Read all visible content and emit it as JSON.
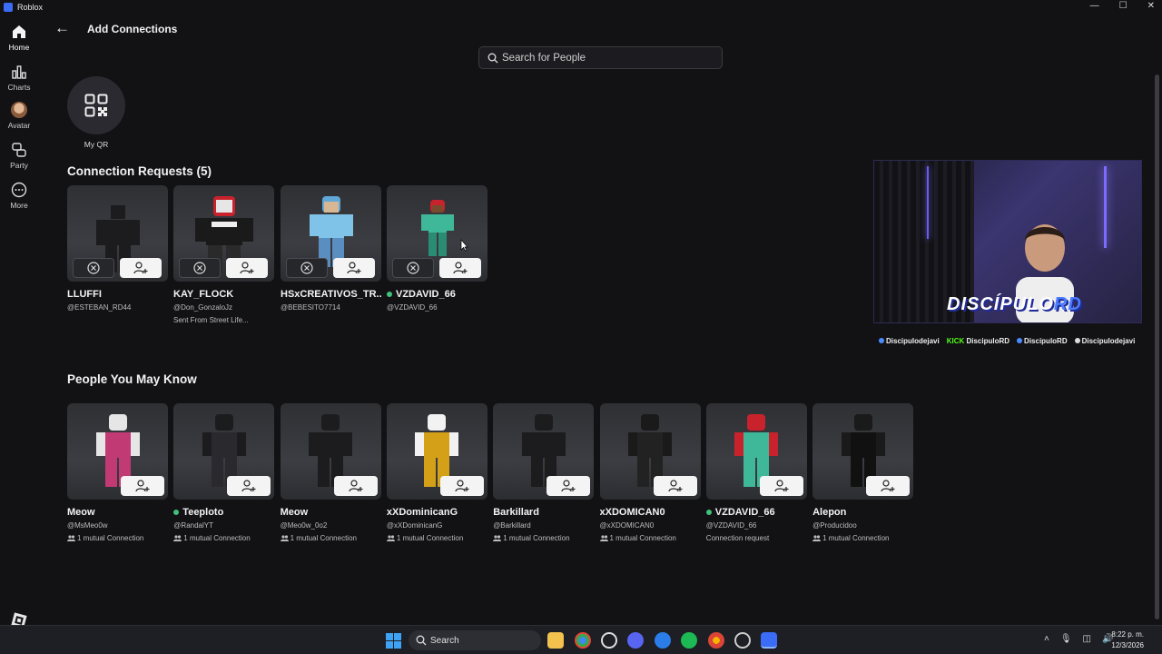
{
  "window": {
    "title": "Roblox",
    "controls": [
      "—",
      "☐",
      "✕"
    ]
  },
  "sidebar": {
    "items": [
      {
        "label": "Home",
        "icon": "home-icon"
      },
      {
        "label": "Charts",
        "icon": "charts-icon"
      },
      {
        "label": "Avatar",
        "icon": "avatar-icon"
      },
      {
        "label": "Party",
        "icon": "party-icon"
      },
      {
        "label": "More",
        "icon": "more-icon"
      }
    ]
  },
  "header": {
    "back": "←",
    "title": "Add Connections"
  },
  "search": {
    "placeholder": "Search for People"
  },
  "qr": {
    "label": "My QR"
  },
  "requests": {
    "title": "Connection Requests (5)",
    "items": [
      {
        "name": "LLUFFI",
        "handle": "@ESTEBAN_RD44",
        "sub": "",
        "online": false
      },
      {
        "name": "KAY_FLOCK",
        "handle": "@Don_GonzaloJz",
        "sub": "Sent From Street Life...",
        "online": false
      },
      {
        "name": "HSxCREATIVOS_TR...",
        "handle": "@BEBESITO7714",
        "sub": "",
        "online": false
      },
      {
        "name": "VZDAVID_66",
        "handle": "@VZDAVID_66",
        "sub": "",
        "online": true
      }
    ]
  },
  "pymk": {
    "title": "People You May Know",
    "items": [
      {
        "name": "Meow",
        "handle": "@MsMeo0w",
        "sub": "1 mutual Connection",
        "online": false
      },
      {
        "name": "Teeploto",
        "handle": "@RandalYT",
        "sub": "1 mutual Connection",
        "online": true
      },
      {
        "name": "Meow",
        "handle": "@Meo0w_0o2",
        "sub": "1 mutual Connection",
        "online": false
      },
      {
        "name": "xXDominicanG",
        "handle": "@xXDominicanG",
        "sub": "1 mutual Connection",
        "online": false
      },
      {
        "name": "Barkillard",
        "handle": "@Barkillard",
        "sub": "1 mutual Connection",
        "online": false
      },
      {
        "name": "xXDOMICAN0",
        "handle": "@xXDOMICAN0",
        "sub": "1 mutual Connection",
        "online": false
      },
      {
        "name": "VZDAVID_66",
        "handle": "@VZDAVID_66",
        "sub": "Connection request",
        "online": true
      },
      {
        "name": "Alepon",
        "handle": "@Producidoo",
        "sub": "1 mutual Connection",
        "online": false
      }
    ]
  },
  "stream": {
    "banner_main": "DISCÍPULO",
    "banner_accent": "RD",
    "socials": [
      {
        "text": "Discipulodejavi",
        "icon": "instagram-icon"
      },
      {
        "text": "DiscipuloRD",
        "prefix": "KICK",
        "icon": "kick-icon"
      },
      {
        "text": "DiscipuloRD",
        "icon": "youtube-icon"
      },
      {
        "text": "Discipulodejavi",
        "icon": "tiktok-icon"
      }
    ]
  },
  "taskbar": {
    "search_label": "Search",
    "time": "8:22 p. m.",
    "date": "12/3/2026",
    "apps": [
      "file-explorer-icon",
      "chrome-icon",
      "chatgpt-icon",
      "discord-icon",
      "app-icon",
      "spotify-icon",
      "chrome-canary-icon",
      "obs-icon",
      "roblox-taskbar-icon"
    ]
  },
  "colors": {
    "background": "#121215",
    "card": "#34353a",
    "online": "#41c27a",
    "accent": "#3b6cf5"
  }
}
